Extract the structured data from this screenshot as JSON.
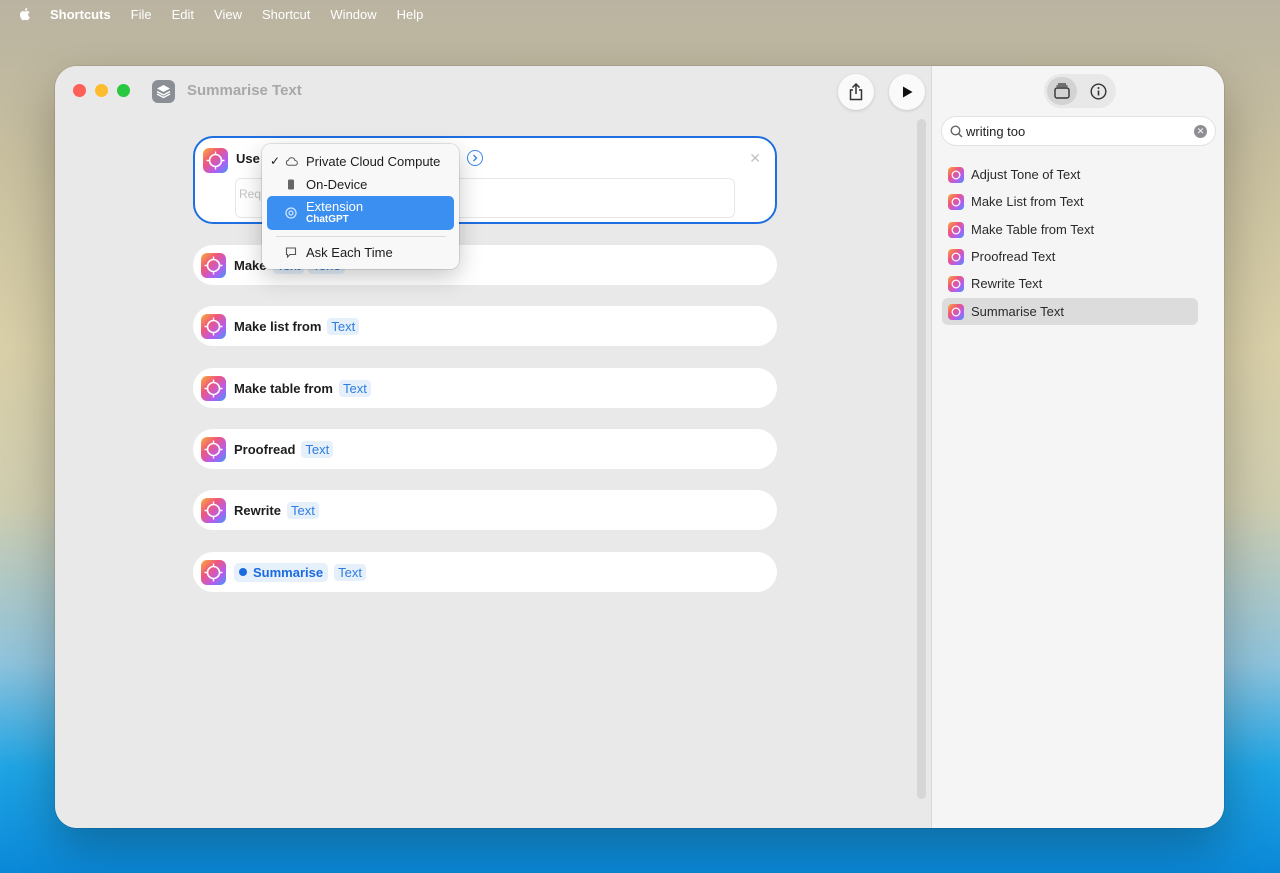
{
  "menubar": {
    "app": "Shortcuts",
    "items": [
      "File",
      "Edit",
      "View",
      "Shortcut",
      "Window",
      "Help"
    ]
  },
  "window": {
    "title": "Summarise Text"
  },
  "actions": {
    "use": {
      "verb": "Use",
      "placeholder": "Req"
    },
    "make": {
      "verb": "Make",
      "chip1": "Text",
      "chip2": "Tone"
    },
    "make_list": {
      "verb": "Make list from",
      "chip": "Text"
    },
    "make_table": {
      "verb": "Make table from",
      "chip": "Text"
    },
    "proofread": {
      "verb": "Proofread",
      "chip": "Text"
    },
    "rewrite": {
      "verb": "Rewrite",
      "chip": "Text"
    },
    "summarise": {
      "verb": "Summarise",
      "chip": "Text"
    }
  },
  "popup": {
    "items": [
      {
        "label": "Private Cloud Compute",
        "checked": true
      },
      {
        "label": "On-Device"
      },
      {
        "label": "Extension",
        "sublabel": "ChatGPT",
        "highlighted": true
      },
      {
        "label": "Ask Each Time"
      }
    ]
  },
  "sidebar": {
    "search_value": "writing too",
    "results": [
      "Adjust Tone of Text",
      "Make List from Text",
      "Make Table from Text",
      "Proofread Text",
      "Rewrite Text",
      "Summarise Text"
    ],
    "selected_index": 5
  },
  "colors": {
    "accent": "#1f6fe0",
    "chip_bg": "#e6f0fb",
    "highlight": "#3b8ff0"
  }
}
